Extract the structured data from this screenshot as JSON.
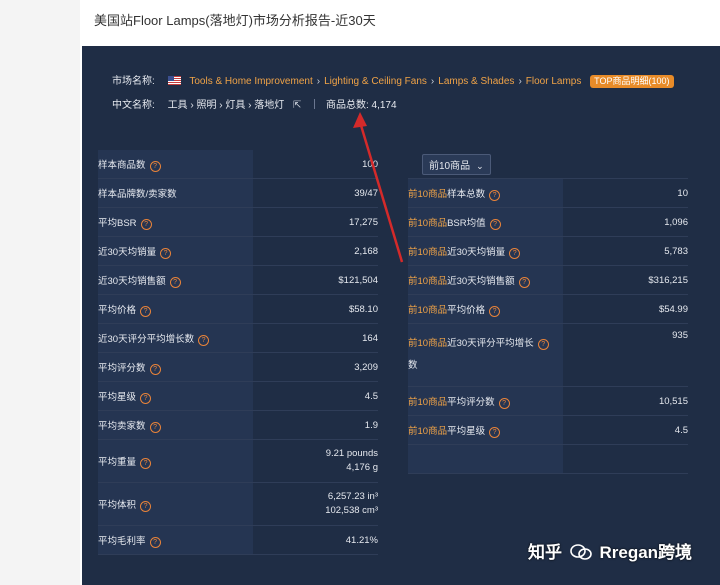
{
  "header": {
    "title": "美国站Floor Lamps(落地灯)市场分析报告-近30天"
  },
  "market": {
    "label": "市场名称:",
    "breadcrumb": [
      "Tools & Home Improvement",
      "Lighting & Ceiling Fans",
      "Lamps & Shades",
      "Floor Lamps"
    ],
    "badge": "TOP商品明细(100)",
    "cn_label": "中文名称:",
    "cn_path": "工具 › 照明 › 灯具 › 落地灯",
    "total_label": "商品总数:",
    "total_value": "4,174"
  },
  "left_stats": [
    {
      "label": "样本商品数",
      "help": true,
      "value": "100"
    },
    {
      "label": "样本品牌数/卖家数",
      "help": false,
      "value": "39/47"
    },
    {
      "label": "平均BSR",
      "help": true,
      "value": "17,275"
    },
    {
      "label": "近30天均销量",
      "help": true,
      "value": "2,168"
    },
    {
      "label": "近30天均销售额",
      "help": true,
      "value": "$121,504"
    },
    {
      "label": "平均价格",
      "help": true,
      "value": "$58.10"
    },
    {
      "label": "近30天评分平均增长数",
      "help": true,
      "value": "164"
    },
    {
      "label": "平均评分数",
      "help": true,
      "value": "3,209"
    },
    {
      "label": "平均星级",
      "help": true,
      "value": "4.5"
    },
    {
      "label": "平均卖家数",
      "help": true,
      "value": "1.9"
    },
    {
      "label": "平均重量",
      "help": true,
      "value": "9.21 pounds",
      "value2": "4,176 g"
    },
    {
      "label": "平均体积",
      "help": true,
      "value": "6,257.23 in³",
      "value2": "102,538 cm³"
    },
    {
      "label": "平均毛利率",
      "help": true,
      "value": "41.21%"
    }
  ],
  "right_select": {
    "value": "前10商品"
  },
  "right_stats": [
    {
      "prefix": "前10商品",
      "label": "样本总数",
      "value": "10"
    },
    {
      "prefix": "前10商品",
      "label": "BSR均值",
      "value": "1,096"
    },
    {
      "prefix": "前10商品",
      "label": "近30天均销量",
      "value": "5,783"
    },
    {
      "prefix": "前10商品",
      "label": "近30天均销售额",
      "value": "$316,215"
    },
    {
      "prefix": "前10商品",
      "label": "平均价格",
      "value": "$54.99"
    },
    {
      "prefix": "前10商品",
      "label": "近30天评分平均增长",
      "label2": "数",
      "value": "935"
    },
    {
      "prefix": "前10商品",
      "label": "平均评分数",
      "value": "10,515"
    },
    {
      "prefix": "前10商品",
      "label": "平均星级",
      "value": "4.5"
    }
  ],
  "help_glyph": "?",
  "watermark": {
    "text1": "知乎",
    "text2": "Rregan跨境"
  },
  "colors": {
    "panel": "#1f2d45",
    "accent": "#f0a347",
    "arrow": "#d42a2a"
  }
}
